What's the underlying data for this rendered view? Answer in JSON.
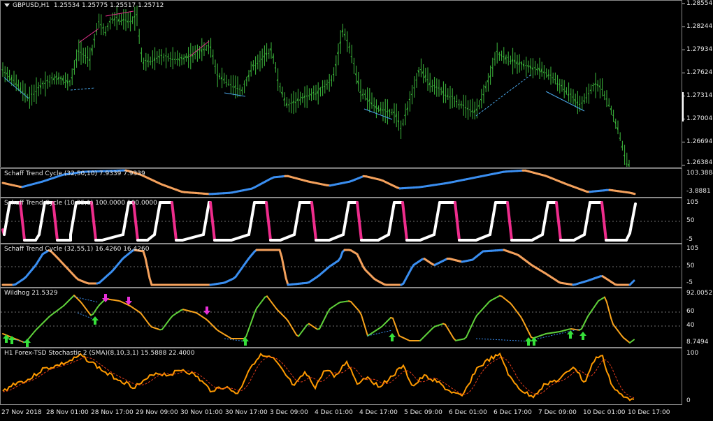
{
  "main": {
    "symbol": "GBPUSD,H1",
    "ohlc": "1.25534 1.25775 1.25517 1.25712",
    "price_labels": [
      "1.28554",
      "1.28244",
      "1.27934",
      "1.27624",
      "1.27314",
      "1.27004",
      "1.26694",
      "1.26384"
    ],
    "colors": {
      "bar": "#3cb83c",
      "up_line": "#e0308a",
      "down_line": "#4aa6e8"
    }
  },
  "panes": [
    {
      "title": "Schaff Trend Cycle (32,50,10) 7.9339 7.9339",
      "labels": [
        "103.3884",
        "-3.8881"
      ]
    },
    {
      "title": "Schaff Trend Cycle (10,25,1) 100.0000 100.0000",
      "labels": [
        "105",
        "50",
        "-5"
      ]
    },
    {
      "title": "Schaff Trend Cycle (32,55,1) 16.4260 16.4260",
      "labels": [
        "105",
        "50",
        "-5"
      ]
    },
    {
      "title": "Wildhog 21.5329",
      "labels": [
        "92.0052",
        "60",
        "40",
        "8.7494"
      ]
    },
    {
      "title": "H1 Forex-TSD Stochastic 2 (SMA)(8,10,3,1) 15.5888 22.4000",
      "labels": [
        "100",
        "0"
      ]
    }
  ],
  "time_labels": [
    "27 Nov 2018",
    "28 Nov 01:00",
    "28 Nov 17:00",
    "29 Nov 09:00",
    "30 Nov 01:00",
    "30 Nov 17:00",
    "3 Dec 09:00",
    "4 Dec 01:00",
    "4 Dec 17:00",
    "5 Dec 09:00",
    "6 Dec 01:00",
    "6 Dec 17:00",
    "7 Dec 09:00",
    "10 Dec 01:00",
    "10 Dec 17:00"
  ],
  "icons": {
    "menu": "dropdown-arrow-icon",
    "up_arrow": "green-up-arrow-icon",
    "down_arrow": "magenta-down-arrow-icon"
  },
  "colors": {
    "orange": "#f4a15c",
    "blue": "#3a8ef0",
    "white": "#ffffff",
    "pink": "#ee2c8c",
    "wild_green": "#5fd03a",
    "wild_orange": "#f7a21b",
    "stoch": "#ff9a00",
    "stoch_signal": "#e03a1a"
  }
}
